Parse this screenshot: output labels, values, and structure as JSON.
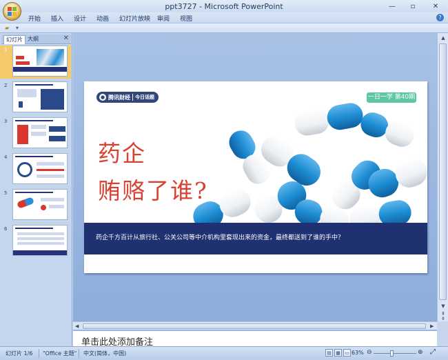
{
  "window": {
    "title": "ppt3727 - Microsoft PowerPoint",
    "minimize": "—",
    "restore": "▫",
    "close": "✕"
  },
  "ribbon_tabs": [
    "开始",
    "插入",
    "设计",
    "动画",
    "幻灯片放映",
    "审阅",
    "视图"
  ],
  "quick_access": {
    "save_icon": "save-icon",
    "undo_icon": "undo-icon",
    "redo_icon": "redo-icon"
  },
  "help": "?",
  "left_panel": {
    "tab_slides": "幻灯片",
    "tab_outline": "大纲",
    "close": "✕",
    "slide_numbers": [
      "1",
      "2",
      "3",
      "4",
      "5",
      "6"
    ],
    "selected_slide": 1
  },
  "slide": {
    "brand_text": "腾讯财经",
    "brand_sub": "今日话题",
    "badge": "一日一学 第40期",
    "headline_line1": "药企",
    "headline_line2": "贿赂了谁?",
    "band_text": "药企千方百计从旅行社、公关公司等中介机构里套现出来的资金，最终都送到了谁的手中？",
    "colors": {
      "headline": "#d8412f",
      "band": "#1f3170",
      "badge": "#5cc7a0",
      "capsule_blue": "#1e8ed4"
    }
  },
  "notes_placeholder": "单击此处添加备注",
  "status": {
    "slide_info": "幻灯片 1/6",
    "theme": "\"Office 主题\"",
    "language": "中文(简体，中国)",
    "zoom": "63%",
    "zoom_minus": "⊖",
    "zoom_plus": "⊕"
  }
}
